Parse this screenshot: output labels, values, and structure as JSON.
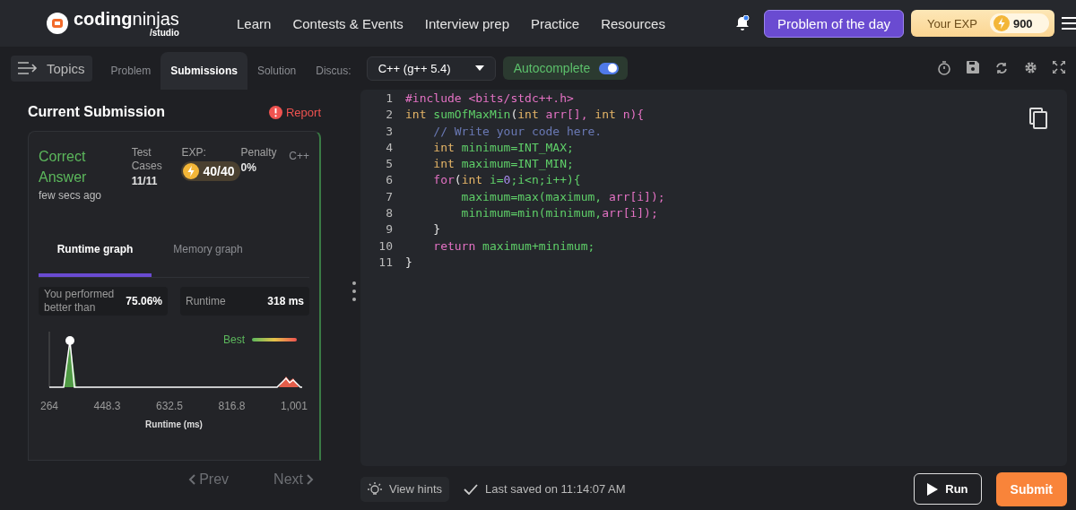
{
  "brand": {
    "name": "**coding**ninjas",
    "sub": "/studio"
  },
  "nav": [
    "Learn",
    "Contests & Events",
    "Interview prep",
    "Practice",
    "Resources"
  ],
  "notification": {
    "unread": true
  },
  "problem_of_day": "Problem of the day",
  "exp": {
    "label": "Your EXP",
    "value": "900"
  },
  "topics": "Topics",
  "tabs": [
    {
      "label": "Problem",
      "selected": false
    },
    {
      "label": "Submissions",
      "selected": true
    },
    {
      "label": "Solution",
      "selected": false
    },
    {
      "label": "Discus:",
      "selected": false
    }
  ],
  "language": "C++ (g++ 5.4)",
  "autocomplete": {
    "label": "Autocomplete",
    "on": true
  },
  "submission": {
    "title": "Current Submission",
    "report": "Report",
    "status": "Correct Answer",
    "time": "few secs ago",
    "tests_label": "Test Cases",
    "tests": "11/11",
    "exp_label": "EXP:",
    "exp": "40/40",
    "penalty_label": "Penalty",
    "penalty": "0%",
    "language": "C++",
    "graph_tabs": [
      {
        "label": "Runtime graph",
        "selected": true
      },
      {
        "label": "Memory graph",
        "selected": false
      }
    ],
    "better_label": "You performed better than",
    "better": "75.06%",
    "runtime_label": "Runtime",
    "runtime": "318 ms",
    "legend": "Best",
    "x_ticks": [
      "264",
      "448.3",
      "632.5",
      "816.8",
      "1,001"
    ],
    "xlabel": "Runtime (ms)"
  },
  "pager": {
    "prev": "Prev",
    "next": "Next"
  },
  "code": [
    {
      "number": "1",
      "tokens": [
        {
          "text": "#include <bits/stdc++.h>",
          "kind": "pre"
        }
      ]
    },
    {
      "number": "2",
      "tokens": [
        {
          "text": "int ",
          "kind": "kw"
        },
        {
          "text": "sumOfMaxMin",
          "kind": "fn"
        },
        {
          "text": "(",
          "kind": "plain"
        },
        {
          "text": "int ",
          "kind": "kw"
        },
        {
          "text": "arr[], ",
          "kind": "pre"
        },
        {
          "text": "int ",
          "kind": "kw"
        },
        {
          "text": "n){",
          "kind": "pre"
        }
      ]
    },
    {
      "number": "3",
      "tokens": [
        {
          "text": "    // Write your code here.",
          "kind": "com"
        }
      ]
    },
    {
      "number": "4",
      "tokens": [
        {
          "text": "    int ",
          "kind": "kw"
        },
        {
          "text": "minimum=INT_MAX;",
          "kind": "fn"
        }
      ]
    },
    {
      "number": "5",
      "tokens": [
        {
          "text": "    int ",
          "kind": "kw"
        },
        {
          "text": "maximum=INT_MIN;",
          "kind": "fn"
        }
      ]
    },
    {
      "number": "6",
      "tokens": [
        {
          "text": "    for",
          "kind": "pre"
        },
        {
          "text": "(",
          "kind": "plain"
        },
        {
          "text": "int ",
          "kind": "kw"
        },
        {
          "text": "i=",
          "kind": "fn"
        },
        {
          "text": "0",
          "kind": "num"
        },
        {
          "text": ";i<n;i++){",
          "kind": "fn"
        }
      ]
    },
    {
      "number": "7",
      "tokens": [
        {
          "text": "        maximum=max(maximum, ",
          "kind": "fn"
        },
        {
          "text": "arr[i]);",
          "kind": "pre"
        }
      ]
    },
    {
      "number": "8",
      "tokens": [
        {
          "text": "        minimum=min(minimum,",
          "kind": "fn"
        },
        {
          "text": "arr[i]);",
          "kind": "pre"
        }
      ]
    },
    {
      "number": "9",
      "tokens": [
        {
          "text": "    }",
          "kind": "plain"
        }
      ]
    },
    {
      "number": "10",
      "tokens": [
        {
          "text": "    return ",
          "kind": "pre"
        },
        {
          "text": "maximum+minimum;",
          "kind": "fn"
        }
      ]
    },
    {
      "number": "11",
      "tokens": [
        {
          "text": "}",
          "kind": "plain"
        }
      ]
    }
  ],
  "hints": "View hints",
  "saved": "Last saved on 11:14:07 AM",
  "run": "Run",
  "submit": "Submit"
}
